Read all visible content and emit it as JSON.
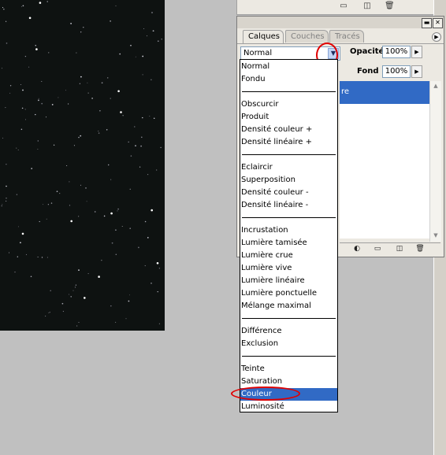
{
  "panel": {
    "tabs": [
      {
        "label": "Calques",
        "active": true
      },
      {
        "label": "Couches",
        "active": false
      },
      {
        "label": "Tracés",
        "active": false
      }
    ],
    "blend_mode_value": "Normal",
    "opacity_label": "Opacité:",
    "opacity_value": "100%",
    "fill_label": "Fond :",
    "fill_value": "100%",
    "selected_layer_fragment": "re"
  },
  "dropdown": {
    "groups": [
      [
        "Normal",
        "Fondu"
      ],
      [
        "Obscurcir",
        "Produit",
        "Densité couleur +",
        "Densité linéaire +"
      ],
      [
        "Eclaircir",
        "Superposition",
        "Densité couleur -",
        "Densité linéaire -"
      ],
      [
        "Incrustation",
        "Lumière tamisée",
        "Lumière crue",
        "Lumière vive",
        "Lumière linéaire",
        "Lumière ponctuelle",
        "Mélange maximal"
      ],
      [
        "Différence",
        "Exclusion"
      ],
      [
        "Teinte",
        "Saturation",
        "Couleur",
        "Luminosité"
      ]
    ],
    "selected": "Couleur"
  },
  "colors": {
    "canvas_bg": "#0e1211",
    "selection": "#316ac5",
    "annotation": "#e00000",
    "workspace": "#c0c0c0"
  },
  "icons": {
    "top_palette": [
      "trash-icon",
      "new-item-icon",
      "folder-icon"
    ],
    "window": [
      "minimize-icon",
      "close-icon"
    ],
    "panel_menu": "panel-menu-arrow-icon",
    "bottom_bar": [
      "adjustment-layer-icon",
      "folder-icon",
      "new-layer-icon",
      "trash-icon"
    ]
  }
}
